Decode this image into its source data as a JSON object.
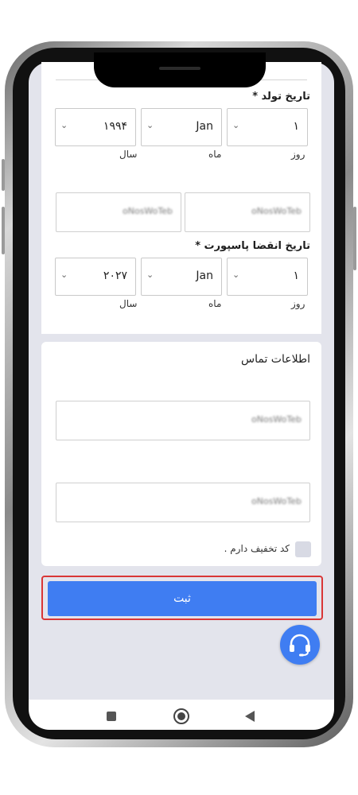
{
  "form": {
    "birth_date": {
      "label": "تاریخ تولد *",
      "day": {
        "value": "۱",
        "label": "روز"
      },
      "month": {
        "value": "Jan",
        "label": "ماه"
      },
      "year": {
        "value": "۱۹۹۴",
        "label": "سال"
      }
    },
    "name_inputs": [
      {
        "value": "oNosWoTeb"
      },
      {
        "value": "oNosWoTeb"
      }
    ],
    "passport_expiry": {
      "label": "تاریخ انقضا پاسپورت *",
      "day": {
        "value": "۱",
        "label": "روز"
      },
      "month": {
        "value": "Jan",
        "label": "ماه"
      },
      "year": {
        "value": "۲۰۲۷",
        "label": "سال"
      }
    }
  },
  "contact": {
    "title": "اطلاعات تماس",
    "inputs": [
      {
        "value": "oNosWoTeb"
      },
      {
        "value": "oNosWoTeb"
      }
    ],
    "discount_checkbox_label": "کد تخفیف دارم ."
  },
  "actions": {
    "submit_label": "ثبت"
  },
  "colors": {
    "primary": "#3f7df2",
    "highlight": "#d93636",
    "background": "#e3e4ec"
  },
  "icons": {
    "support": "headset-icon",
    "select_chevron": "chevron-down-icon",
    "nav_recents": "square-icon",
    "nav_home": "circle-icon",
    "nav_back": "triangle-back-icon"
  }
}
